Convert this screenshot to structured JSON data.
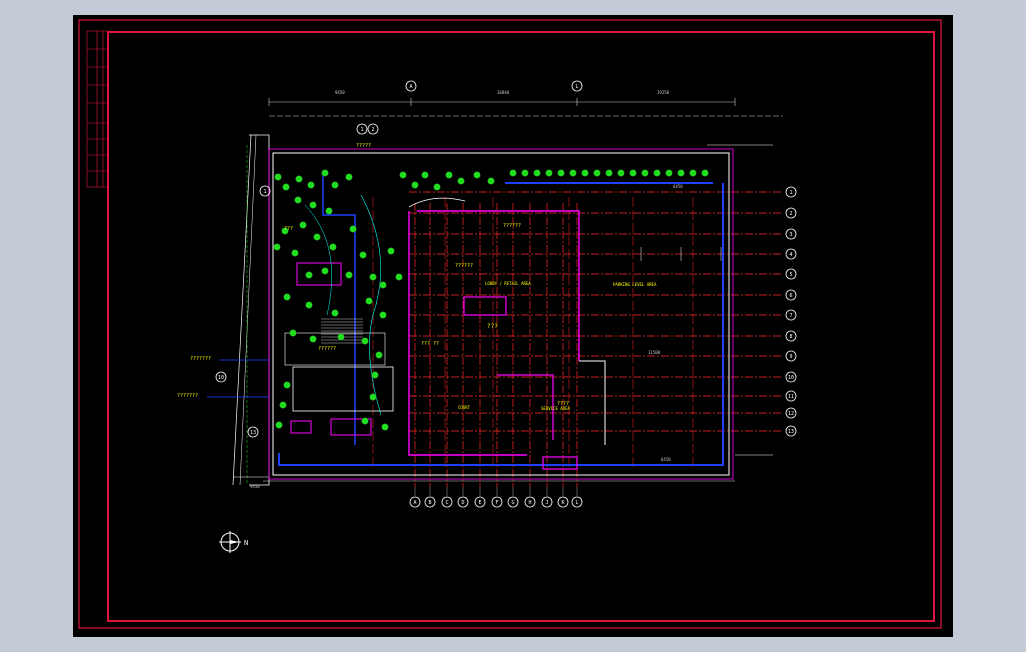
{
  "drawing": {
    "grid_letters_bottom": [
      "A",
      "B",
      "C",
      "D",
      "E",
      "F",
      "G",
      "H",
      "J",
      "K",
      "L"
    ],
    "grid_letters_top": [
      "A",
      "L"
    ],
    "grid_numbers_right": [
      "1",
      "2",
      "3",
      "4",
      "5",
      "6",
      "7",
      "8",
      "9",
      "10",
      "11",
      "12",
      "13"
    ],
    "grid_numbers_left": [
      "1",
      "10",
      "13"
    ],
    "areas": {
      "parking": "PARKING LEVEL AREA",
      "lobby": "LOBBY / RETAIL AREA",
      "court": "COURT",
      "service": "SERVICE AREA"
    },
    "placeholder_labels": [
      "?????",
      "??????",
      "??????",
      "???",
      "??????",
      "???",
      "??? ??",
      "????",
      "???????",
      "???????"
    ],
    "dims": [
      "9450",
      "16840",
      "19250",
      "6450",
      "11500",
      "6450",
      "9450"
    ],
    "north_symbol": "N",
    "colors": {
      "background": "#000000",
      "frame": "#e0143c",
      "grid": "#ff2a2a",
      "walls": "#ffffff",
      "magenta": "#ff00ff",
      "blue": "#2040ff",
      "cyan": "#00ffff",
      "yellow": "#ffff00",
      "green": "#22dd22"
    }
  }
}
